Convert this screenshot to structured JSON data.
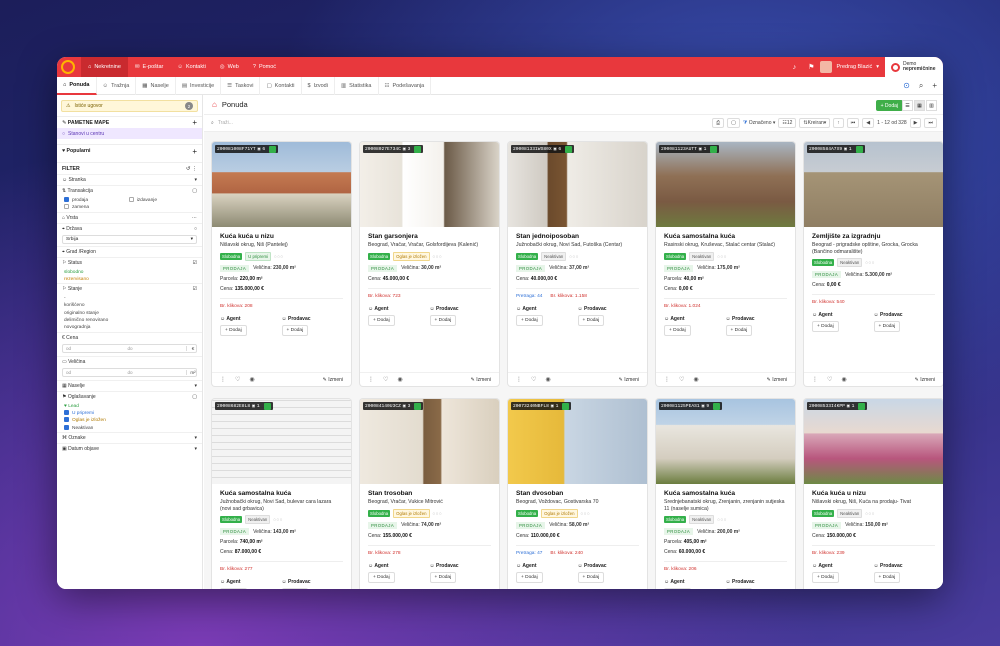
{
  "topbar": {
    "tabs": [
      {
        "icon": "home-icon",
        "label": "Nekretnine",
        "active": true
      },
      {
        "icon": "mail-icon",
        "label": "E-poštar"
      },
      {
        "icon": "contacts-icon",
        "label": "Kontakti"
      },
      {
        "icon": "globe-icon",
        "label": "Web"
      },
      {
        "icon": "help-icon",
        "label": "Pomoć"
      }
    ],
    "user_name": "Predrag Blazić",
    "brand_line1": "Demo",
    "brand_line2": "nepremičnine"
  },
  "subnav": {
    "tabs": [
      {
        "icon": "house-icon",
        "label": "Ponuda",
        "active": true
      },
      {
        "icon": "people-icon",
        "label": "Tražnja"
      },
      {
        "icon": "building-icon",
        "label": "Naselje"
      },
      {
        "icon": "investment-icon",
        "label": "Investicije"
      },
      {
        "icon": "tasks-icon",
        "label": "Taskovi"
      },
      {
        "icon": "contacts-icon",
        "label": "Kontakti"
      },
      {
        "icon": "cost-icon",
        "label": "Izvodi"
      },
      {
        "icon": "stats-icon",
        "label": "Statistika"
      },
      {
        "icon": "settings-icon",
        "label": "Podešavanja"
      }
    ]
  },
  "sidebar": {
    "warning": {
      "label": "Istiće ugovor",
      "count": "2"
    },
    "smart_maps_title": "PAMETNE MAPE",
    "smart_map_item": "Stanovi u centru",
    "popular_title": "Popularni",
    "filter_title": "FILTER",
    "stranka": "Stranka",
    "transakcija": "Transakcija",
    "transakcija_opts": {
      "prodaja": "prodaja",
      "izdavanje": "izdavanje",
      "zamena": "zamena"
    },
    "vrsta": "Vrsta",
    "drzava": "Država",
    "drzava_value": "Srbija",
    "grad": "Grad /Region",
    "status": "Status",
    "status_opts": {
      "a": "slobodno",
      "b": "rezervisano"
    },
    "stanje": "Stanje",
    "stanje_opts": {
      "a": "-",
      "b": "korišćeno",
      "c": "originalno stanje",
      "d": "delimično renovirano",
      "e": "novogradnja"
    },
    "cena": "Cena",
    "od": "od",
    "do": "do",
    "cena_unit": "€",
    "velicina": "Veličina",
    "velicina_unit": "m²",
    "naselje": "Naselje",
    "oglasavanje": "Oglašavanje",
    "oglasavanje_opts": {
      "lead": "Lead",
      "prep": "U pripremi",
      "ogl": "Oglas je izložen",
      "nea": "Neaktivan"
    },
    "oznake": "Oznake",
    "datum": "Datum objave"
  },
  "main": {
    "title": "Ponuda",
    "add_label": "+ Dodaj",
    "search_placeholder": "Traži...",
    "oznaceno": "Označeno",
    "per_page": "12",
    "sort": "Kreiran",
    "pagination": "1 - 12 od 328"
  },
  "listings": [
    {
      "id": "200081008F71YT",
      "photos": "6",
      "title": "Kuća kuća u nizu",
      "loc": "Nišavski okrug, Niš (Pantelej)",
      "tags": [
        "Slobodna",
        "U pripremi"
      ],
      "parcela": "220,00 m²",
      "velicina": "230,00 m²",
      "cena": "135.000,00 €",
      "clicks": "Br. klikova: 208",
      "pretraga": "",
      "sale": "PRODAJA"
    },
    {
      "id": "20008027E734C",
      "photos": "3",
      "title": "Stan garsonjera",
      "loc": "Beograd, Vračar, Vračar, Golsfordijeva (Kalenić)",
      "tags": [
        "Slobodna",
        "Oglas je izložen"
      ],
      "parcela": "",
      "velicina": "30,00 m²",
      "cena": "45.000,00 €",
      "clicks": "Br. klikova: 723",
      "pretraga": "",
      "sale": "PRODAJA"
    },
    {
      "id": "200081331WS80X",
      "photos": "6",
      "title": "Stan jednoiposoban",
      "loc": "Južnobački okrug, Novi Sad, Futoška (Centar)",
      "tags": [
        "Slobodna",
        "Neaktivan"
      ],
      "parcela": "",
      "velicina": "37,00 m²",
      "cena": "40.000,00 €",
      "clicks": "Br. klikova: 1.158",
      "pretraga": "Pretraga: 44",
      "sale": "PRODAJA"
    },
    {
      "id": "200081123AUTT",
      "photos": "1",
      "title": "Kuća samostalna kuća",
      "loc": "Rasinski okrug, Kruševac, Stalać centar (Stalać)",
      "tags": [
        "Slobodna",
        "Neaktivan"
      ],
      "parcela": "40,00 m²",
      "velicina": "175,00 m²",
      "cena": "0,00 €",
      "clicks": "Br. klikova: 1.024",
      "pretraga": "",
      "sale": "PRODAJA"
    },
    {
      "id": "20008584A7X9",
      "photos": "1",
      "title": "Zemljište za izgradnju",
      "loc": "Beograd - prigradske opštine, Grocka, Grocka (Bančino odmaralište)",
      "tags": [
        "Slobodna",
        "Neaktivan"
      ],
      "parcela": "",
      "velicina": "5.300,00 m²",
      "cena": "0,00 €",
      "clicks": "Br. klikova: 540",
      "pretraga": "",
      "sale": "PRODAJA"
    },
    {
      "id": "20008682E8L8",
      "photos": "1",
      "title": "Kuća samostalna kuća",
      "loc": "Južnobački okrug, Novi Sad, bulevar cara lazara (novi sad grbavica)",
      "tags": [
        "Slobodna",
        "Neaktivan"
      ],
      "parcela": "740,00 m²",
      "velicina": "143,00 m²",
      "cena": "87.000,00 €",
      "clicks": "Br. klikova: 277",
      "pretraga": "",
      "sale": "PRODAJA"
    },
    {
      "id": "200084140U3CZ",
      "photos": "3",
      "title": "Stan trosoban",
      "loc": "Beograd, Vračar, Vukice Mitrović",
      "tags": [
        "Slobodna",
        "Oglas je izložen"
      ],
      "parcela": "",
      "velicina": "74,00 m²",
      "cena": "155.000,00 €",
      "clicks": "Br. klikova: 278",
      "pretraga": "",
      "sale": "PRODAJA"
    },
    {
      "id": "20073240NBFL8",
      "photos": "1",
      "title": "Stan dvosoban",
      "loc": "Beograd, Voždovac, Gostivarska 70",
      "tags": [
        "Slobodna",
        "Oglas je izložen"
      ],
      "parcela": "",
      "velicina": "58,00 m²",
      "cena": "110.000,00 €",
      "clicks": "Br. klikova: 240",
      "pretraga": "Pretraga: 47",
      "sale": "PRODAJA"
    },
    {
      "id": "200081125PEAS1",
      "photos": "9",
      "title": "Kuća samostalna kuća",
      "loc": "Srednjebanatski okrug, Zrenjanin, zrenjanin sutjeska 11 (naselje sumica)",
      "tags": [
        "Slobodna",
        "Neaktivan"
      ],
      "parcela": "405,00 m²",
      "velicina": "200,00 m²",
      "cena": "60.000,00 €",
      "clicks": "Br. klikova: 206",
      "pretraga": "",
      "sale": "PRODAJA"
    },
    {
      "id": "20008533I4KPP",
      "photos": "1",
      "title": "Kuća kuća u nizu",
      "loc": "Nišavski okrug, Niš, Kuća na prodaju- Tivat",
      "tags": [
        "Slobodna",
        "Neaktivan"
      ],
      "parcela": "",
      "velicina": "150,00 m²",
      "cena": "150.000,00 €",
      "clicks": "Br. klikova: 239",
      "pretraga": "",
      "sale": "PRODAJA"
    }
  ],
  "labels": {
    "parcela": "Parcela:",
    "velicina": "Veličina:",
    "cena": "Cena:",
    "agent": "Agent",
    "prodavac": "Prodavac",
    "dodaj": "+ Dodaj",
    "izmeni": "Izmeni"
  },
  "colors": {
    "primary": "#e8383d",
    "success": "#3fae49",
    "accent": "#5a34b5"
  }
}
